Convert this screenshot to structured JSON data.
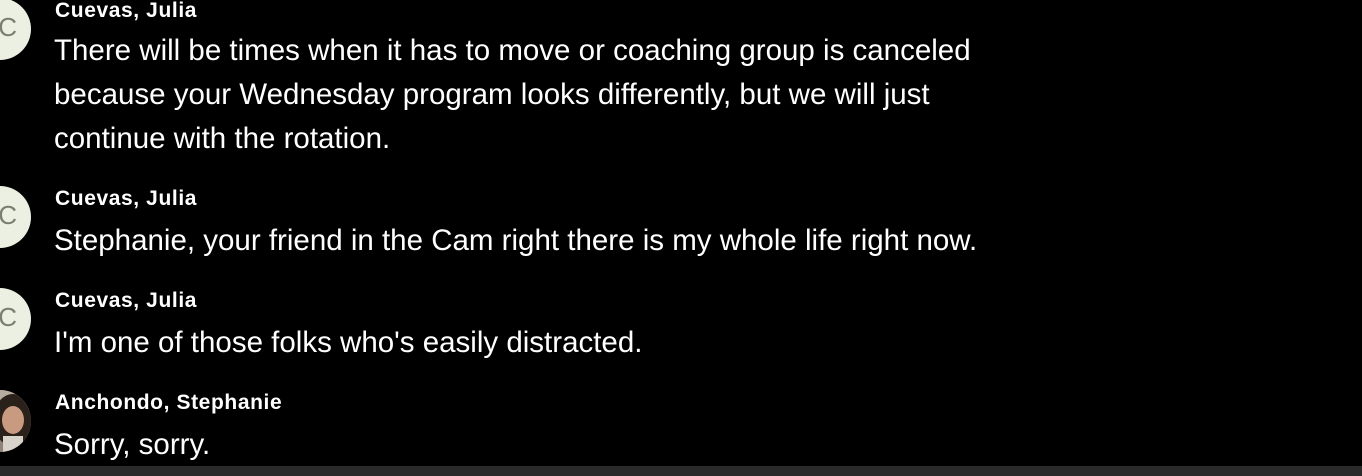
{
  "transcript": {
    "entries": [
      {
        "speaker": "Cuevas, Julia",
        "avatar_initial": "C",
        "lines": [
          "There will be times when it has to move or coaching group is canceled",
          "because your Wednesday program looks differently, but we will just",
          "continue with the rotation."
        ]
      },
      {
        "speaker": "Cuevas, Julia",
        "avatar_initial": "C",
        "lines": [
          "Stephanie, your friend in the Cam right there is my whole life right now."
        ]
      },
      {
        "speaker": "Cuevas, Julia",
        "avatar_initial": "C",
        "lines": [
          "I'm one of those folks who's easily distracted."
        ]
      },
      {
        "speaker": "Anchondo, Stephanie",
        "avatar_initial": "",
        "lines": [
          "Sorry, sorry."
        ]
      }
    ]
  },
  "colors": {
    "background": "#000000",
    "text": "#ffffff",
    "initial_avatar_bg": "#ecf0e2",
    "initial_avatar_text": "#7b7f70",
    "bottom_bar": "#2a2a2a"
  }
}
